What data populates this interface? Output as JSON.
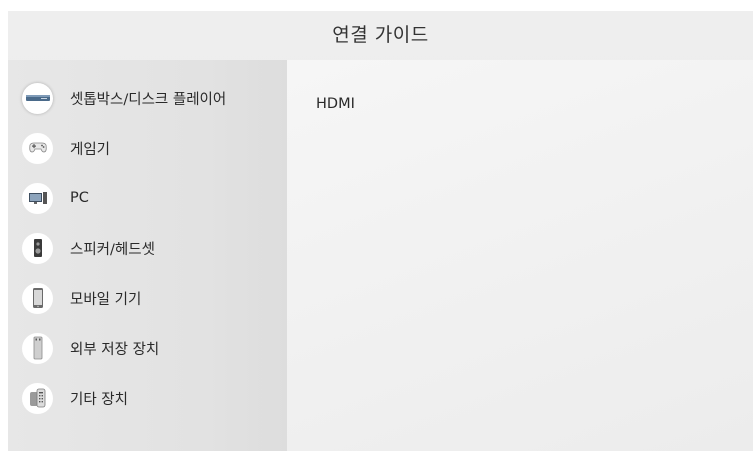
{
  "header": {
    "title": "연결 가이드"
  },
  "sidebar": {
    "items": [
      {
        "label": "셋톱박스/디스크 플레이어",
        "icon": "settop-box-icon",
        "selected": true
      },
      {
        "label": "게임기",
        "icon": "gamepad-icon",
        "selected": false
      },
      {
        "label": "PC",
        "icon": "pc-icon",
        "selected": false
      },
      {
        "label": "스피커/헤드셋",
        "icon": "speaker-icon",
        "selected": false
      },
      {
        "label": "모바일 기기",
        "icon": "mobile-device-icon",
        "selected": false
      },
      {
        "label": "외부 저장 장치",
        "icon": "usb-storage-icon",
        "selected": false
      },
      {
        "label": "기타 장치",
        "icon": "remote-control-icon",
        "selected": false
      }
    ]
  },
  "content": {
    "items": [
      {
        "label": "HDMI"
      }
    ]
  }
}
